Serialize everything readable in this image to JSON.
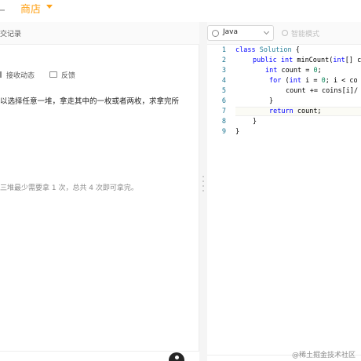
{
  "nav": {
    "shop": "商店"
  },
  "left": {
    "tab_submissions": "交记录",
    "actions": {
      "subscribe": "接收动态",
      "feedback": "反馈"
    },
    "description": "以选择任意一堆，拿走其中的一枚或者两枚，求拿完所",
    "example_note": "三堆最少需要拿 1 次，总共 4 次即可拿完。"
  },
  "editor": {
    "language": "Java",
    "smart_mode": "智能模式",
    "line_numbers": [
      "1",
      "2",
      "3",
      "4",
      "5",
      "6",
      "7",
      "8",
      "9"
    ],
    "code": {
      "l1": [
        "class",
        "Solution",
        "{"
      ],
      "l2": [
        "public",
        "int",
        "minCount(",
        "int",
        "[] c"
      ],
      "l3": [
        "int",
        "count = ",
        "0",
        ";"
      ],
      "l4": [
        "for",
        "(",
        "int",
        "i = ",
        "0",
        "; i < co"
      ],
      "l5": "count += coins[i]/",
      "l6": "}",
      "l7": [
        "return",
        "count;"
      ],
      "l8": "}",
      "l9": "}"
    }
  },
  "watermark": "@稀土掘金技术社区",
  "colors": {
    "accent": "#ffa116",
    "keyword": "#0000ff",
    "type": "#267f99",
    "number": "#098658",
    "line_number": "#237893"
  }
}
